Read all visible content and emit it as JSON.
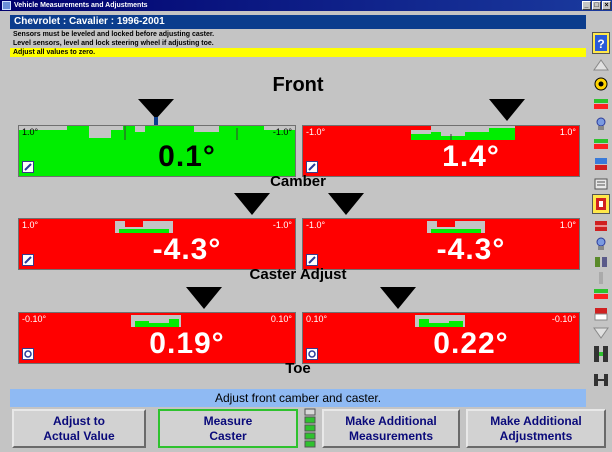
{
  "window": {
    "title": "Vehicle Measurements and Adjustments",
    "buttons": [
      "_",
      "□",
      "×"
    ]
  },
  "vehicle": {
    "label": "Chevrolet : Cavalier : 1996-2001"
  },
  "instructions": {
    "line1": "Sensors must be leveled and locked before adjusting caster.",
    "line2": "Level sensors, level and lock steering wheel if adjusting toe.",
    "line3": "Adjust all values to zero."
  },
  "main": {
    "heading": "Front",
    "sections": {
      "camber": {
        "label": "Camber",
        "left": {
          "min": "1.0°",
          "max": "-1.0°",
          "value": "0.1°",
          "status": "in-spec"
        },
        "right": {
          "min": "-1.0°",
          "max": "1.0°",
          "value": "1.4°",
          "status": "out-of-spec"
        }
      },
      "caster": {
        "label": "Caster Adjust",
        "left": {
          "min": "1.0°",
          "max": "-1.0°",
          "value": "-4.3°",
          "status": "out-of-spec"
        },
        "right": {
          "min": "-1.0°",
          "max": "1.0°",
          "value": "-4.3°",
          "status": "out-of-spec"
        }
      },
      "toe": {
        "label": "Toe",
        "left": {
          "min": "-0.10°",
          "max": "0.10°",
          "value": "0.19°",
          "status": "out-of-spec"
        },
        "right": {
          "min": "0.10°",
          "max": "-0.10°",
          "value": "0.22°",
          "status": "out-of-spec"
        }
      }
    }
  },
  "status_bar": {
    "text": "Adjust front camber and caster."
  },
  "bottom_buttons": {
    "adjust_actual": {
      "line1": "Adjust to",
      "line2": "Actual Value"
    },
    "measure_caster": {
      "line1": "Measure",
      "line2": "Caster"
    },
    "additional_measurements": {
      "line1": "Make Additional",
      "line2": "Measurements"
    },
    "additional_adjustments": {
      "line1": "Make Additional",
      "line2": "Adjustments"
    }
  },
  "colors": {
    "in_spec": "#00ee00",
    "out_of_spec": "#ff0000",
    "status_bar": "#8fbaf3",
    "vehicle_bar": "#0b3d8d",
    "highlight": "#ffff00"
  },
  "toolbar_icons": [
    "help-icon",
    "target-icon",
    "vehicle-specs-icon",
    "sensor-icon",
    "vehicle-specs-icon",
    "report-icon",
    "print-icon",
    "wheel-icon",
    "shims-icon",
    "sensor-icon",
    "tools-icon",
    "vehicle-specs-icon",
    "flag-icon",
    "alignment-icon"
  ]
}
